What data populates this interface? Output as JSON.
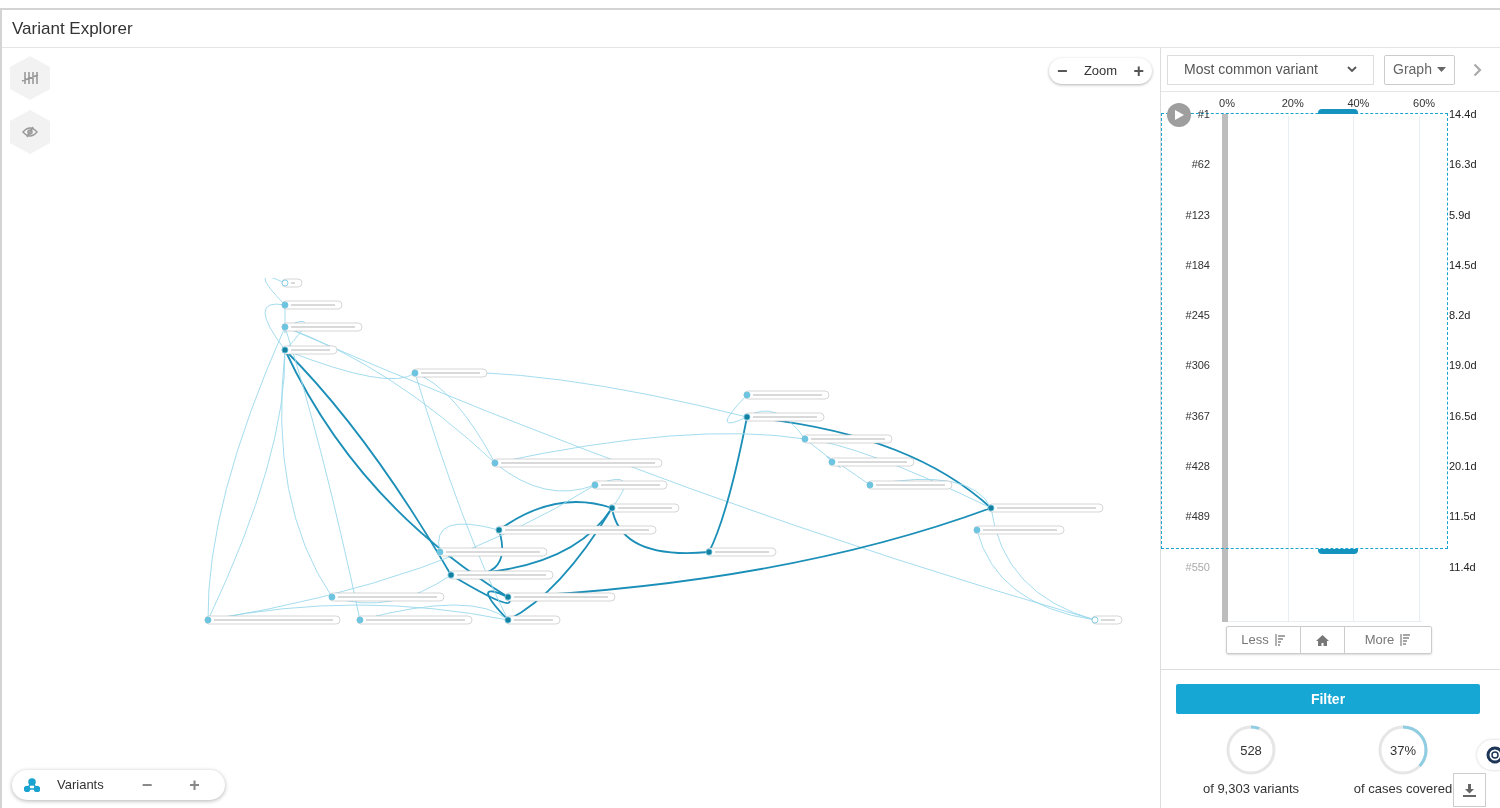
{
  "window": {
    "title": "Variant Explorer"
  },
  "canvas": {
    "zoom_label": "Zoom",
    "zoom_out": "−",
    "zoom_in": "+",
    "variants_label": "Variants",
    "variants_minus": "−",
    "variants_plus": "+"
  },
  "panel": {
    "sort_select": "Most common variant",
    "view_button": "Graph",
    "ticks": [
      "0%",
      "20%",
      "40%",
      "60%"
    ],
    "rows": [
      {
        "rank": "#1",
        "duration": "14.4d",
        "in_selection": true
      },
      {
        "rank": "#62",
        "duration": "16.3d",
        "in_selection": true
      },
      {
        "rank": "#123",
        "duration": "5.9d",
        "in_selection": true
      },
      {
        "rank": "#184",
        "duration": "14.5d",
        "in_selection": true
      },
      {
        "rank": "#245",
        "duration": "8.2d",
        "in_selection": true
      },
      {
        "rank": "#306",
        "duration": "19.0d",
        "in_selection": true
      },
      {
        "rank": "#367",
        "duration": "16.5d",
        "in_selection": true
      },
      {
        "rank": "#428",
        "duration": "20.1d",
        "in_selection": true
      },
      {
        "rank": "#489",
        "duration": "11.5d",
        "in_selection": true
      },
      {
        "rank": "#550",
        "duration": "11.4d",
        "in_selection": false
      }
    ],
    "less_button": "Less",
    "more_button": "More",
    "filter_button": "Filter",
    "stats": [
      {
        "value": "528",
        "caption": "of 9,303 variants",
        "level": 0.057
      },
      {
        "value": "37%",
        "caption": "of cases covered",
        "level": 0.37
      }
    ]
  }
}
